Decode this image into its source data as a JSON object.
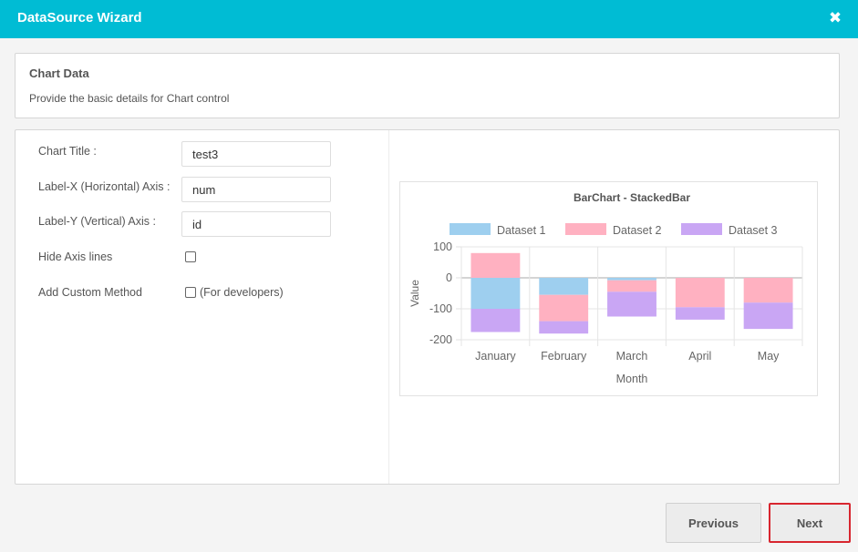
{
  "header": {
    "title": "DataSource Wizard",
    "close_glyph": "✖"
  },
  "info": {
    "title": "Chart Data",
    "subtitle": "Provide the basic details for Chart control"
  },
  "form": {
    "chart_title_label": "Chart Title :",
    "chart_title_value": "test3",
    "label_x_label": "Label-X (Horizontal) Axis :",
    "label_x_value": "num",
    "label_y_label": "Label-Y (Vertical) Axis :",
    "label_y_value": "id",
    "hide_axis_label": "Hide Axis lines",
    "hide_axis_checked": false,
    "custom_method_label": "Add Custom Method",
    "custom_method_note": "(For developers)",
    "custom_method_checked": false
  },
  "chart_data": {
    "type": "bar",
    "stacked": true,
    "title": "BarChart - StackedBar",
    "xlabel": "Month",
    "ylabel": "Value",
    "categories": [
      "January",
      "February",
      "March",
      "April",
      "May"
    ],
    "ylim": [
      -200,
      100
    ],
    "yticks": [
      100,
      0,
      -100,
      -200
    ],
    "legend_position": "top",
    "series": [
      {
        "name": "Dataset 1",
        "color": "#9ecfef",
        "values": [
          -100,
          -55,
          -8,
          0,
          0
        ]
      },
      {
        "name": "Dataset 2",
        "color": "#ffb1c1",
        "values": [
          80,
          -85,
          -37,
          -95,
          -80
        ]
      },
      {
        "name": "Dataset 3",
        "color": "#c9a6f4",
        "values": [
          -75,
          -40,
          -80,
          -40,
          -85
        ]
      }
    ]
  },
  "buttons": {
    "previous": "Previous",
    "next": "Next"
  }
}
